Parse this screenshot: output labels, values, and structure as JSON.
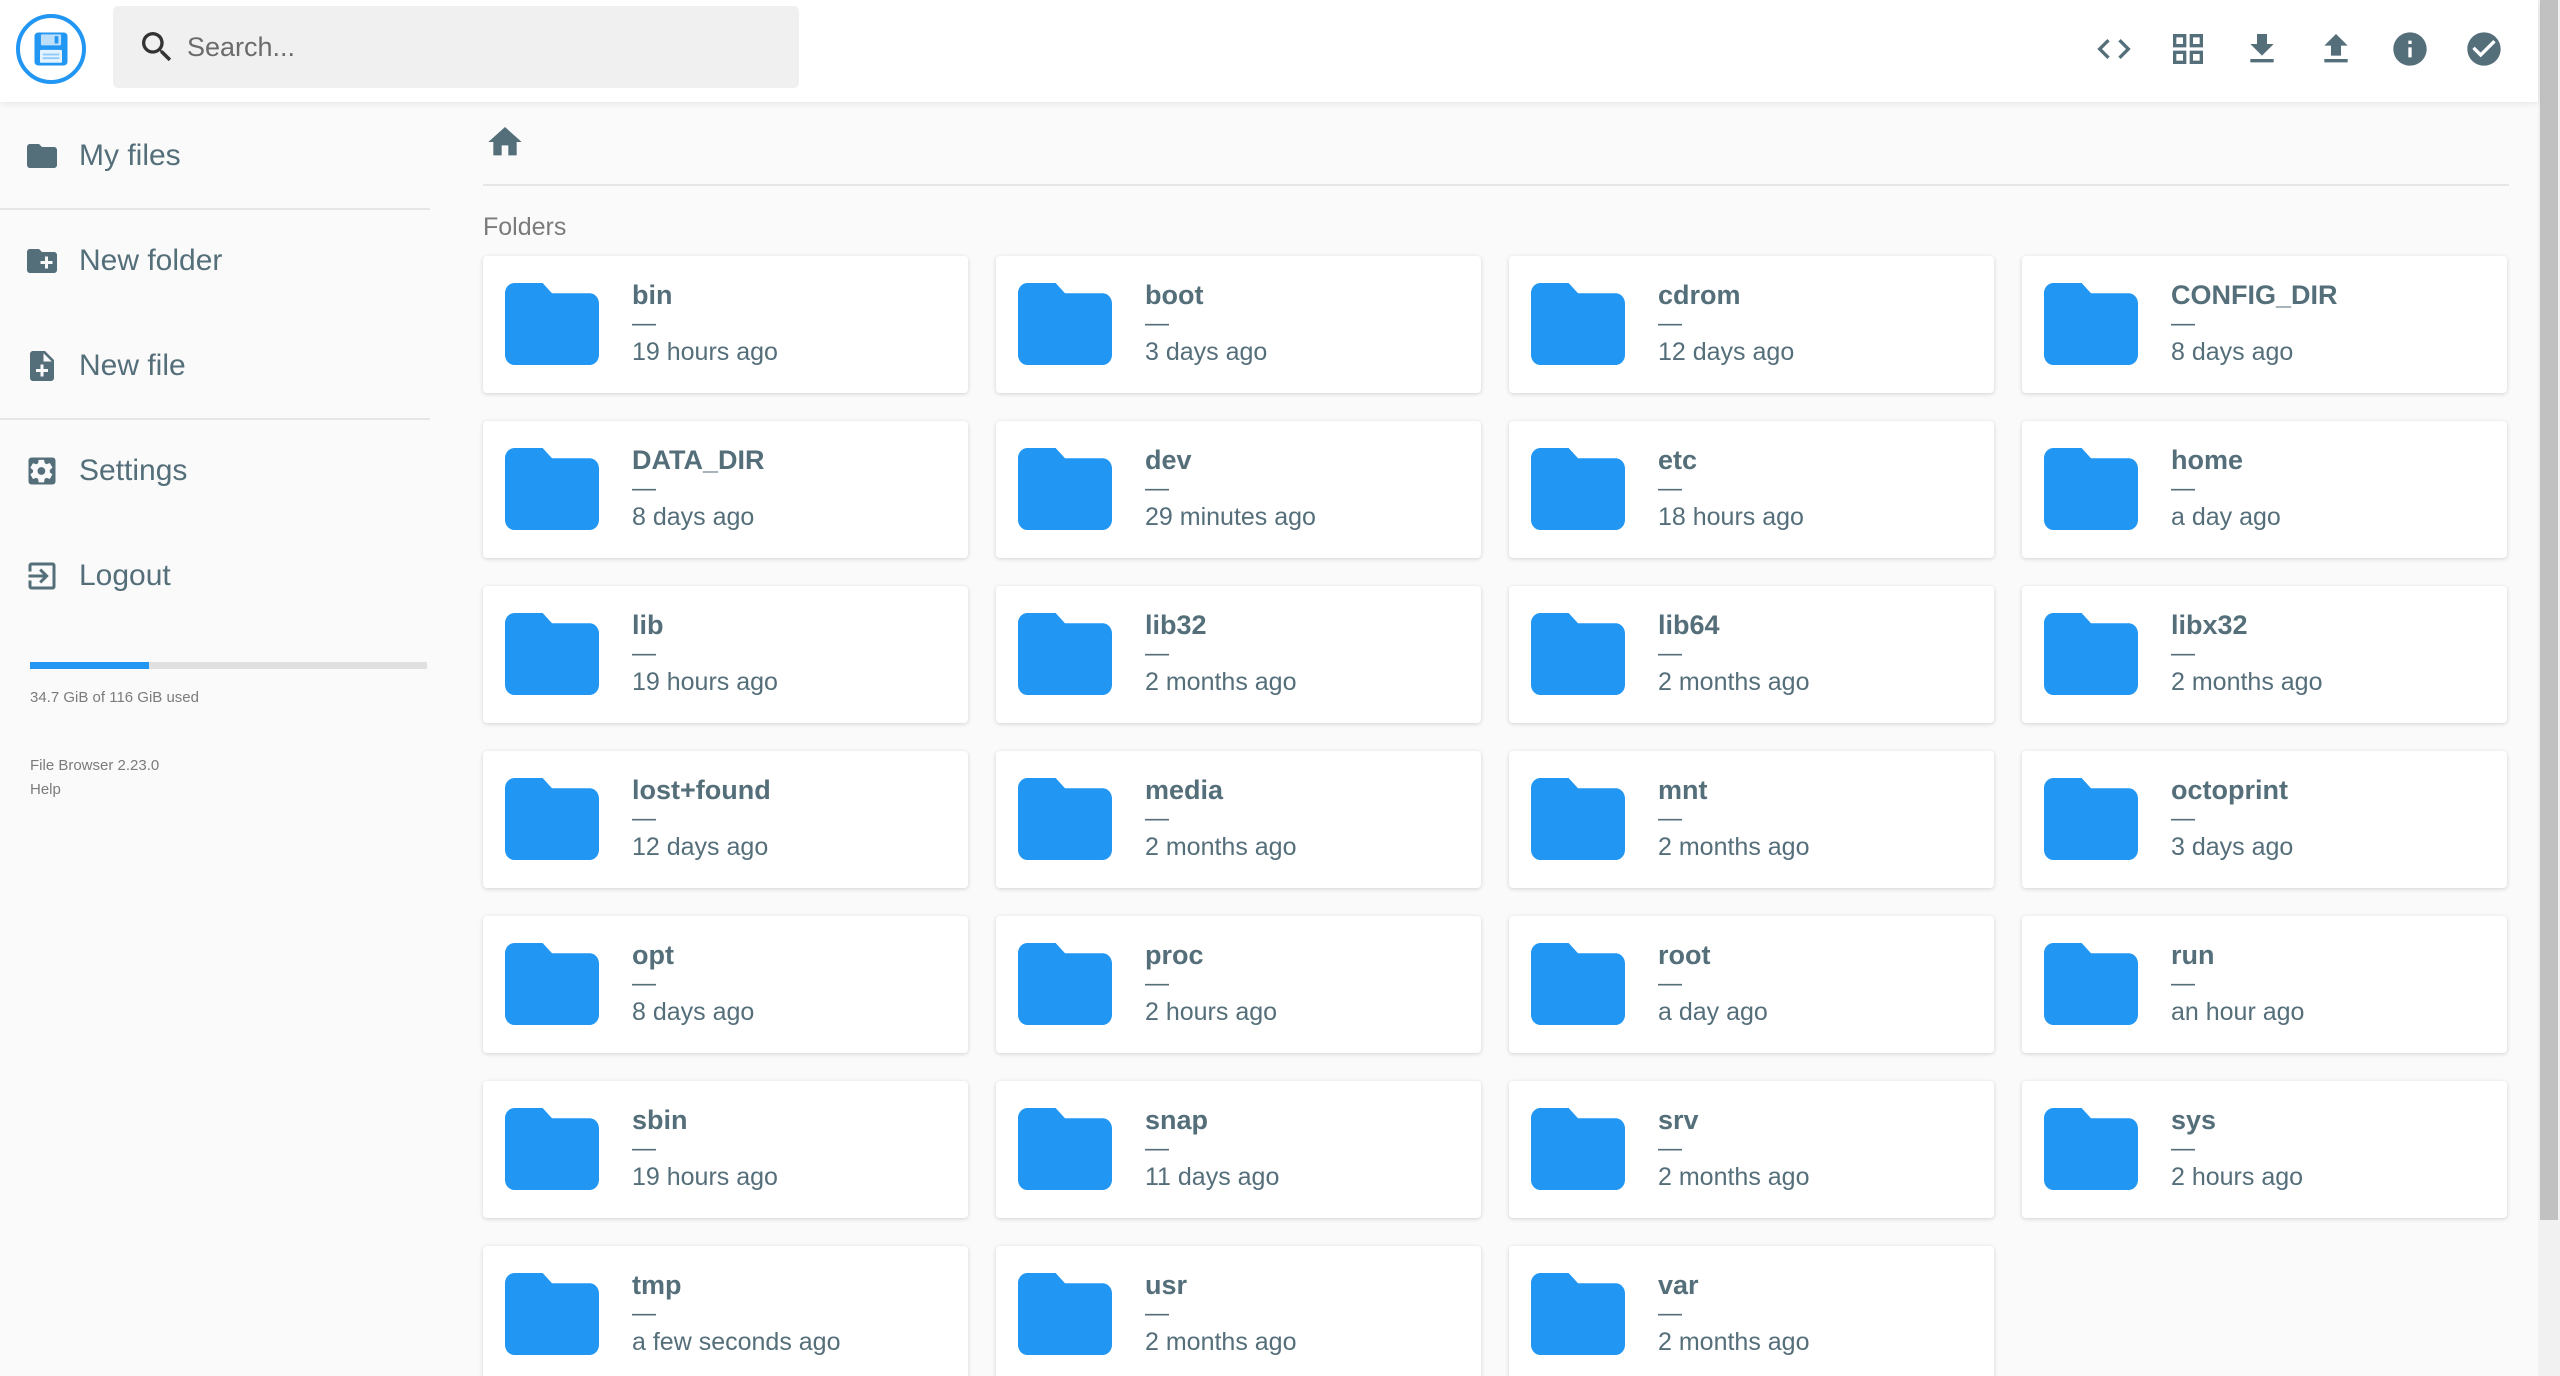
{
  "header": {
    "search_placeholder": "Search..."
  },
  "toolbar": {
    "buttons": [
      "code-icon",
      "grid-view-icon",
      "download-icon",
      "upload-icon",
      "info-icon",
      "check-circle-icon"
    ]
  },
  "sidebar": {
    "items": [
      {
        "label": "My files",
        "icon": "folder-icon"
      },
      {
        "label": "New folder",
        "icon": "create-new-folder-icon"
      },
      {
        "label": "New file",
        "icon": "note-add-icon"
      },
      {
        "label": "Settings",
        "icon": "settings-icon"
      },
      {
        "label": "Logout",
        "icon": "exit-icon"
      }
    ],
    "usage": {
      "text": "34.7 GiB of 116 GiB used",
      "fraction": 0.299
    },
    "version": "File Browser 2.23.0",
    "help": "Help"
  },
  "main": {
    "section_title": "Folders",
    "folders": [
      {
        "name": "bin",
        "size": "—",
        "modified": "19 hours ago"
      },
      {
        "name": "boot",
        "size": "—",
        "modified": "3 days ago"
      },
      {
        "name": "cdrom",
        "size": "—",
        "modified": "12 days ago"
      },
      {
        "name": "CONFIG_DIR",
        "size": "—",
        "modified": "8 days ago"
      },
      {
        "name": "DATA_DIR",
        "size": "—",
        "modified": "8 days ago"
      },
      {
        "name": "dev",
        "size": "—",
        "modified": "29 minutes ago"
      },
      {
        "name": "etc",
        "size": "—",
        "modified": "18 hours ago"
      },
      {
        "name": "home",
        "size": "—",
        "modified": "a day ago"
      },
      {
        "name": "lib",
        "size": "—",
        "modified": "19 hours ago"
      },
      {
        "name": "lib32",
        "size": "—",
        "modified": "2 months ago"
      },
      {
        "name": "lib64",
        "size": "—",
        "modified": "2 months ago"
      },
      {
        "name": "libx32",
        "size": "—",
        "modified": "2 months ago"
      },
      {
        "name": "lost+found",
        "size": "—",
        "modified": "12 days ago"
      },
      {
        "name": "media",
        "size": "—",
        "modified": "2 months ago"
      },
      {
        "name": "mnt",
        "size": "—",
        "modified": "2 months ago"
      },
      {
        "name": "octoprint",
        "size": "—",
        "modified": "3 days ago"
      },
      {
        "name": "opt",
        "size": "—",
        "modified": "8 days ago"
      },
      {
        "name": "proc",
        "size": "—",
        "modified": "2 hours ago"
      },
      {
        "name": "root",
        "size": "—",
        "modified": "a day ago"
      },
      {
        "name": "run",
        "size": "—",
        "modified": "an hour ago"
      },
      {
        "name": "sbin",
        "size": "—",
        "modified": "19 hours ago"
      },
      {
        "name": "snap",
        "size": "—",
        "modified": "11 days ago"
      },
      {
        "name": "srv",
        "size": "—",
        "modified": "2 months ago"
      },
      {
        "name": "sys",
        "size": "—",
        "modified": "2 hours ago"
      },
      {
        "name": "tmp",
        "size": "—",
        "modified": "a few seconds ago"
      },
      {
        "name": "usr",
        "size": "—",
        "modified": "2 months ago"
      },
      {
        "name": "var",
        "size": "—",
        "modified": "2 months ago"
      }
    ]
  },
  "colors": {
    "accent": "#2196f3",
    "text": "#546e7a",
    "icon": "#546e7a"
  }
}
